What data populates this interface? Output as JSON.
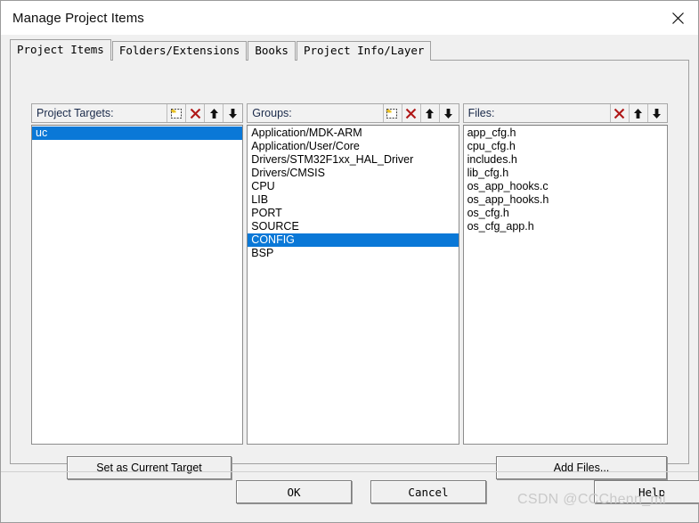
{
  "window": {
    "title": "Manage Project Items",
    "close_icon": "close-icon"
  },
  "tabs": [
    {
      "label": "Project Items",
      "active": true
    },
    {
      "label": "Folders/Extensions",
      "active": false
    },
    {
      "label": "Books",
      "active": false
    },
    {
      "label": "Project Info/Layer",
      "active": false
    }
  ],
  "panels": {
    "targets": {
      "header": "Project Targets:",
      "tools": [
        "new-item-icon",
        "delete-icon",
        "move-up-icon",
        "move-down-icon"
      ],
      "items": [
        {
          "label": "uc",
          "selected": true
        }
      ]
    },
    "groups": {
      "header": "Groups:",
      "tools": [
        "new-item-icon",
        "delete-icon",
        "move-up-icon",
        "move-down-icon"
      ],
      "items": [
        {
          "label": "Application/MDK-ARM",
          "selected": false
        },
        {
          "label": "Application/User/Core",
          "selected": false
        },
        {
          "label": "Drivers/STM32F1xx_HAL_Driver",
          "selected": false
        },
        {
          "label": "Drivers/CMSIS",
          "selected": false
        },
        {
          "label": "CPU",
          "selected": false
        },
        {
          "label": "LIB",
          "selected": false
        },
        {
          "label": "PORT",
          "selected": false
        },
        {
          "label": "SOURCE",
          "selected": false
        },
        {
          "label": "CONFIG",
          "selected": true
        },
        {
          "label": "BSP",
          "selected": false
        }
      ]
    },
    "files": {
      "header": "Files:",
      "tools": [
        "delete-icon",
        "move-up-icon",
        "move-down-icon"
      ],
      "items": [
        {
          "label": "app_cfg.h",
          "selected": false
        },
        {
          "label": "cpu_cfg.h",
          "selected": false
        },
        {
          "label": "includes.h",
          "selected": false
        },
        {
          "label": "lib_cfg.h",
          "selected": false
        },
        {
          "label": "os_app_hooks.c",
          "selected": false
        },
        {
          "label": "os_app_hooks.h",
          "selected": false
        },
        {
          "label": "os_cfg.h",
          "selected": false
        },
        {
          "label": "os_cfg_app.h",
          "selected": false
        }
      ]
    }
  },
  "actions": {
    "set_current_target": "Set as Current Target",
    "add_files": "Add Files..."
  },
  "footer": {
    "ok": "OK",
    "cancel": "Cancel",
    "help": "Help"
  },
  "watermark": "CSDN @CCChenn_mi",
  "colors": {
    "selection": "#0a78d7",
    "dialog_bg": "#f0f0f0",
    "list_bg": "#ffffff",
    "header_label": "#1a2a4a",
    "delete_icon": "#b01818"
  }
}
